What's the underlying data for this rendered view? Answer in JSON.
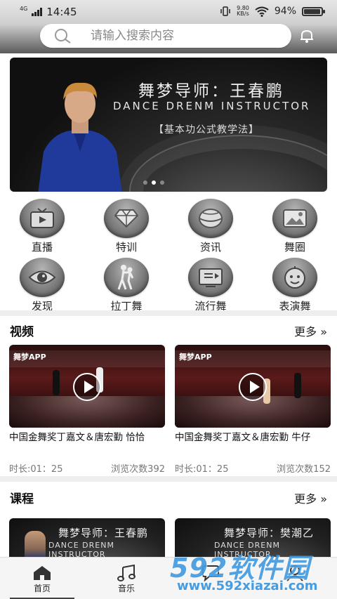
{
  "status_bar": {
    "time": "14:45",
    "network": "4G",
    "speed_value": "9.80",
    "speed_unit": "KB/s",
    "battery_percent": "94%",
    "battery_level": 0.94
  },
  "search": {
    "placeholder": "请输入搜索内容"
  },
  "banner": {
    "title": "舞梦导师：王春鹏",
    "subtitle": "DANCE DRENM INSTRUCTOR",
    "tagline": "【基本功公式教学法】",
    "slides": 3,
    "active_slide": 1
  },
  "categories": [
    {
      "label": "直播",
      "icon": "tv-icon"
    },
    {
      "label": "特训",
      "icon": "diamond-icon"
    },
    {
      "label": "资讯",
      "icon": "globe-icon"
    },
    {
      "label": "舞圈",
      "icon": "image-icon"
    },
    {
      "label": "发现",
      "icon": "eye-icon"
    },
    {
      "label": "拉丁舞",
      "icon": "dancer-icon"
    },
    {
      "label": "流行舞",
      "icon": "video-icon"
    },
    {
      "label": "表演舞",
      "icon": "face-icon"
    }
  ],
  "videos_section": {
    "title": "视频",
    "more": "更多 »",
    "items": [
      {
        "title": "中国金舞奖丁嘉文＆唐宏勤 恰恰",
        "duration": "时长:01：25",
        "views": "浏览次数392",
        "brand": "舞梦APP"
      },
      {
        "title": "中国金舞奖丁嘉文＆唐宏勤 牛仔",
        "duration": "时长:01：25",
        "views": "浏览次数152",
        "brand": "舞梦APP"
      }
    ]
  },
  "courses_section": {
    "title": "课程",
    "more": "更多 »",
    "items": [
      {
        "title": "舞梦导师：王春鹏",
        "subtitle": "DANCE DRENM INSTRUCTOR"
      },
      {
        "title": "舞梦导师：樊潮乙",
        "subtitle": "DANCE DRENM INSTRUCTOR"
      }
    ]
  },
  "bottom_nav": {
    "items": [
      {
        "label": "首页",
        "icon": "home-icon",
        "active": true
      },
      {
        "label": "音乐",
        "icon": "music-icon",
        "active": false
      },
      {
        "label": "",
        "icon": "chat-icon",
        "active": false
      },
      {
        "label": "",
        "icon": "profile-icon",
        "active": false
      }
    ]
  },
  "watermark": {
    "brand": "592软件园",
    "url": "www.592xiazai.com"
  }
}
